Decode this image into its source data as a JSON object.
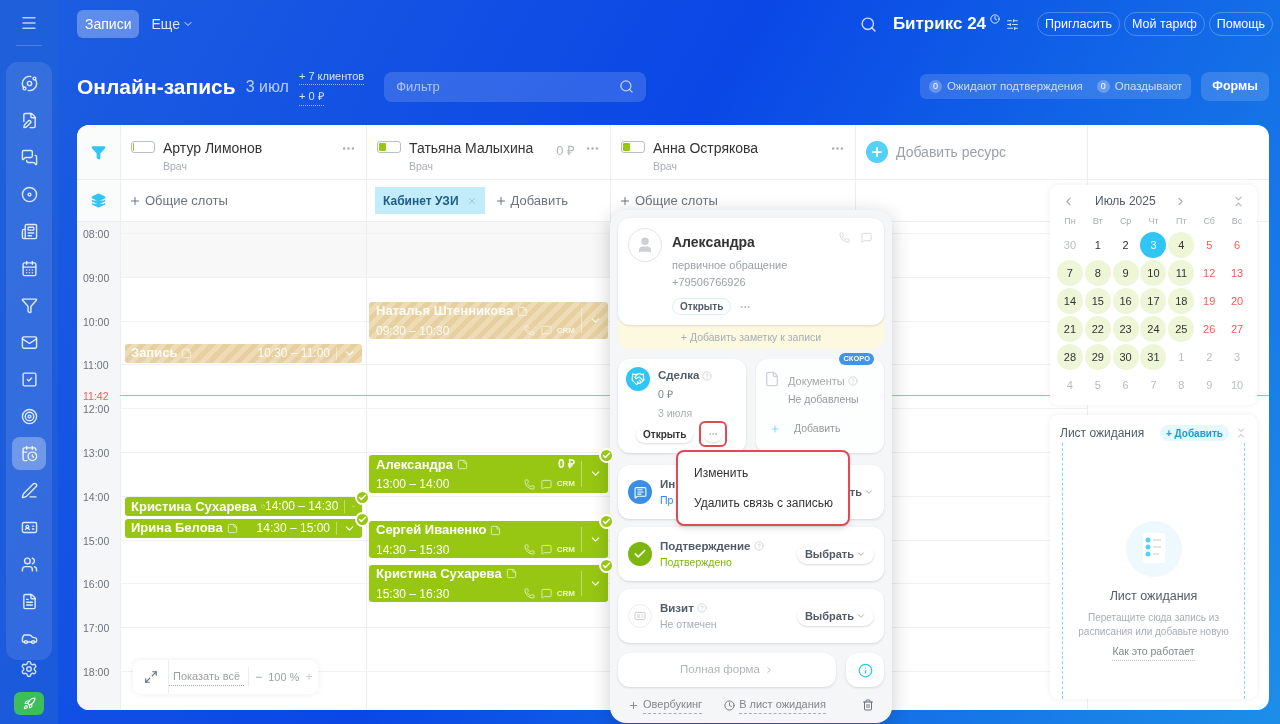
{
  "sidebar": {
    "items": [
      {
        "selected": false
      },
      {
        "selected": false
      },
      {
        "selected": false
      },
      {
        "selected": false
      },
      {
        "selected": false
      },
      {
        "selected": false
      },
      {
        "selected": false
      },
      {
        "selected": false
      },
      {
        "selected": false
      },
      {
        "selected": false
      },
      {
        "selected": true
      },
      {
        "selected": false
      },
      {
        "selected": false
      },
      {
        "selected": false
      },
      {
        "selected": false
      },
      {
        "selected": false
      }
    ]
  },
  "top_bar": {
    "tabs": [
      {
        "label": "Записи",
        "selected": true
      },
      {
        "label": "Еще",
        "selected": false
      }
    ],
    "logo": "Битрикс 24",
    "buttons": [
      "Пригласить",
      "Мой тариф",
      "Помощь"
    ]
  },
  "header": {
    "title": "Онлайн-запись",
    "date": "3 июл",
    "stats": [
      "+ 7 клиентов",
      "+ 0 ₽"
    ],
    "filter": {
      "placeholder": "Фильтр"
    },
    "counters": [
      {
        "count": "0",
        "label": "Ожидают подтверждения"
      },
      {
        "count": "0",
        "label": "Опаздывают"
      }
    ],
    "forms_button": "Формы"
  },
  "columns": [
    {
      "name": "Артур Лимонов",
      "role": "Врач",
      "level": 0.05,
      "slots": [
        {
          "kind": "add",
          "label": "Общие слоты"
        }
      ],
      "events": [
        {
          "kind": "pending",
          "name": "Запись",
          "time": "10:30 – 11:00",
          "checked": false
        },
        {
          "kind": "confirmed",
          "name": "Кристина Сухарева",
          "time": "14:00 – 14:30",
          "checked": true
        },
        {
          "kind": "confirmed",
          "name": "Ирина Белова",
          "time": "14:30 – 15:00",
          "checked": true
        }
      ]
    },
    {
      "name": "Татьяна Малыхина",
      "role": "Врач",
      "level": 0.35,
      "amount": "0 ₽",
      "slots": [
        {
          "kind": "tag",
          "label": "Кабинет УЗИ"
        },
        {
          "kind": "add",
          "label": "Добавить"
        }
      ],
      "events": [
        {
          "kind": "pending",
          "name": "Наталья Штенникова",
          "time": "09:30 – 10:30",
          "crm": "CRM",
          "checked": false
        },
        {
          "kind": "confirmed",
          "name": "Александра",
          "time": "13:00 – 14:00",
          "amount": "0 ₽",
          "crm": "CRM",
          "checked": true
        },
        {
          "kind": "confirmed",
          "name": "Сергей Иваненко",
          "time": "14:30 – 15:30",
          "crm": "CRM",
          "checked": true
        },
        {
          "kind": "confirmed",
          "name": "Кристина Сухарева",
          "time": "15:30 – 16:30",
          "crm": "CRM",
          "checked": true
        }
      ]
    },
    {
      "name": "Анна Острякова",
      "role": "Врач",
      "level": 0.35,
      "slots": [
        {
          "kind": "add",
          "label": "Общие слоты"
        }
      ]
    }
  ],
  "add_resource": "Добавить ресурс",
  "time_labels": [
    "08:00",
    "09:00",
    "10:00",
    "11:00",
    "12:00",
    "13:00",
    "14:00",
    "15:00",
    "16:00",
    "17:00",
    "18:00"
  ],
  "now_marker": "11:42",
  "zoom": {
    "show_all": "Показать всё",
    "minus": "−",
    "value": "100 %",
    "plus": "+"
  },
  "popup": {
    "client": {
      "name": "Александра",
      "description": "первичное обращение",
      "phone": "+79506766926",
      "open_button": "Открыть"
    },
    "add_note": "+ Добавить заметку к записи",
    "deal": {
      "title": "Сделка",
      "amount": "0 ₽",
      "date": "3 июля",
      "open_button": "Открыть"
    },
    "documents": {
      "badge": "СКОРО",
      "title": "Документы",
      "status": "Не добавлены",
      "add": "Добавить",
      "disabled": true
    },
    "info": {
      "title": "Ин",
      "subtitle": "Пр",
      "button": "ть"
    },
    "confirmation": {
      "title": "Подтверждение",
      "status": "Подтверждено",
      "confirmed": true,
      "button": "Выбрать"
    },
    "visit": {
      "title": "Визит",
      "status": "Не отмечен",
      "button": "Выбрать"
    },
    "full_form": "Полная форма",
    "overbooking": "Овербукинг",
    "waitlist": "В лист ожидания",
    "menu": [
      "Изменить",
      "Удалить связь с записью"
    ]
  },
  "calendar": {
    "title": "Июль 2025",
    "weekdays": [
      "Пн",
      "Вт",
      "Ср",
      "Чт",
      "Пт",
      "Сб",
      "Вс"
    ],
    "days": [
      {
        "day": "30",
        "kind": "muted",
        "available": false,
        "selected": false
      },
      {
        "day": "1",
        "kind": "normal",
        "available": false,
        "selected": false
      },
      {
        "day": "2",
        "kind": "normal",
        "available": false,
        "selected": false
      },
      {
        "day": "3",
        "kind": "normal",
        "available": false,
        "selected": true
      },
      {
        "day": "4",
        "kind": "normal",
        "available": true,
        "selected": false
      },
      {
        "day": "5",
        "kind": "weekend",
        "available": false,
        "selected": false
      },
      {
        "day": "6",
        "kind": "weekend",
        "available": false,
        "selected": false
      },
      {
        "day": "7",
        "kind": "normal",
        "available": true,
        "selected": false
      },
      {
        "day": "8",
        "kind": "normal",
        "available": true,
        "selected": false
      },
      {
        "day": "9",
        "kind": "normal",
        "available": true,
        "selected": false
      },
      {
        "day": "10",
        "kind": "normal",
        "available": true,
        "selected": false
      },
      {
        "day": "11",
        "kind": "normal",
        "available": true,
        "selected": false
      },
      {
        "day": "12",
        "kind": "weekend",
        "available": false,
        "selected": false
      },
      {
        "day": "13",
        "kind": "weekend",
        "available": false,
        "selected": false
      },
      {
        "day": "14",
        "kind": "normal",
        "available": true,
        "selected": false
      },
      {
        "day": "15",
        "kind": "normal",
        "available": true,
        "selected": false
      },
      {
        "day": "16",
        "kind": "normal",
        "available": true,
        "selected": false
      },
      {
        "day": "17",
        "kind": "normal",
        "available": true,
        "selected": false
      },
      {
        "day": "18",
        "kind": "normal",
        "available": true,
        "selected": false
      },
      {
        "day": "19",
        "kind": "weekend",
        "available": false,
        "selected": false
      },
      {
        "day": "20",
        "kind": "weekend",
        "available": false,
        "selected": false
      },
      {
        "day": "21",
        "kind": "normal",
        "available": true,
        "selected": false
      },
      {
        "day": "22",
        "kind": "normal",
        "available": true,
        "selected": false
      },
      {
        "day": "23",
        "kind": "normal",
        "available": true,
        "selected": false
      },
      {
        "day": "24",
        "kind": "normal",
        "available": true,
        "selected": false
      },
      {
        "day": "25",
        "kind": "normal",
        "available": true,
        "selected": false
      },
      {
        "day": "26",
        "kind": "weekend",
        "available": false,
        "selected": false
      },
      {
        "day": "27",
        "kind": "weekend",
        "available": false,
        "selected": false
      },
      {
        "day": "28",
        "kind": "normal",
        "available": true,
        "selected": false
      },
      {
        "day": "29",
        "kind": "normal",
        "available": true,
        "selected": false
      },
      {
        "day": "30",
        "kind": "normal",
        "available": true,
        "selected": false
      },
      {
        "day": "31",
        "kind": "normal",
        "available": true,
        "selected": false
      },
      {
        "day": "1",
        "kind": "muted",
        "available": false,
        "selected": false
      },
      {
        "day": "2",
        "kind": "muted",
        "available": false,
        "selected": false
      },
      {
        "day": "3",
        "kind": "muted",
        "available": false,
        "selected": false
      },
      {
        "day": "4",
        "kind": "muted",
        "available": false,
        "selected": false
      },
      {
        "day": "5",
        "kind": "muted",
        "available": false,
        "selected": false
      },
      {
        "day": "6",
        "kind": "muted",
        "available": false,
        "selected": false
      },
      {
        "day": "7",
        "kind": "muted",
        "available": false,
        "selected": false
      },
      {
        "day": "8",
        "kind": "muted",
        "available": false,
        "selected": false
      },
      {
        "day": "9",
        "kind": "muted",
        "available": false,
        "selected": false
      },
      {
        "day": "10",
        "kind": "muted",
        "available": false,
        "selected": false
      }
    ]
  },
  "waiting_list": {
    "title": "Лист ожидания",
    "add_button": "+ Добавить",
    "empty_title": "Лист ожидания",
    "empty_text": "Перетащите сюда запись из расписания или добавьте новую",
    "help_link": "Как это работает"
  }
}
